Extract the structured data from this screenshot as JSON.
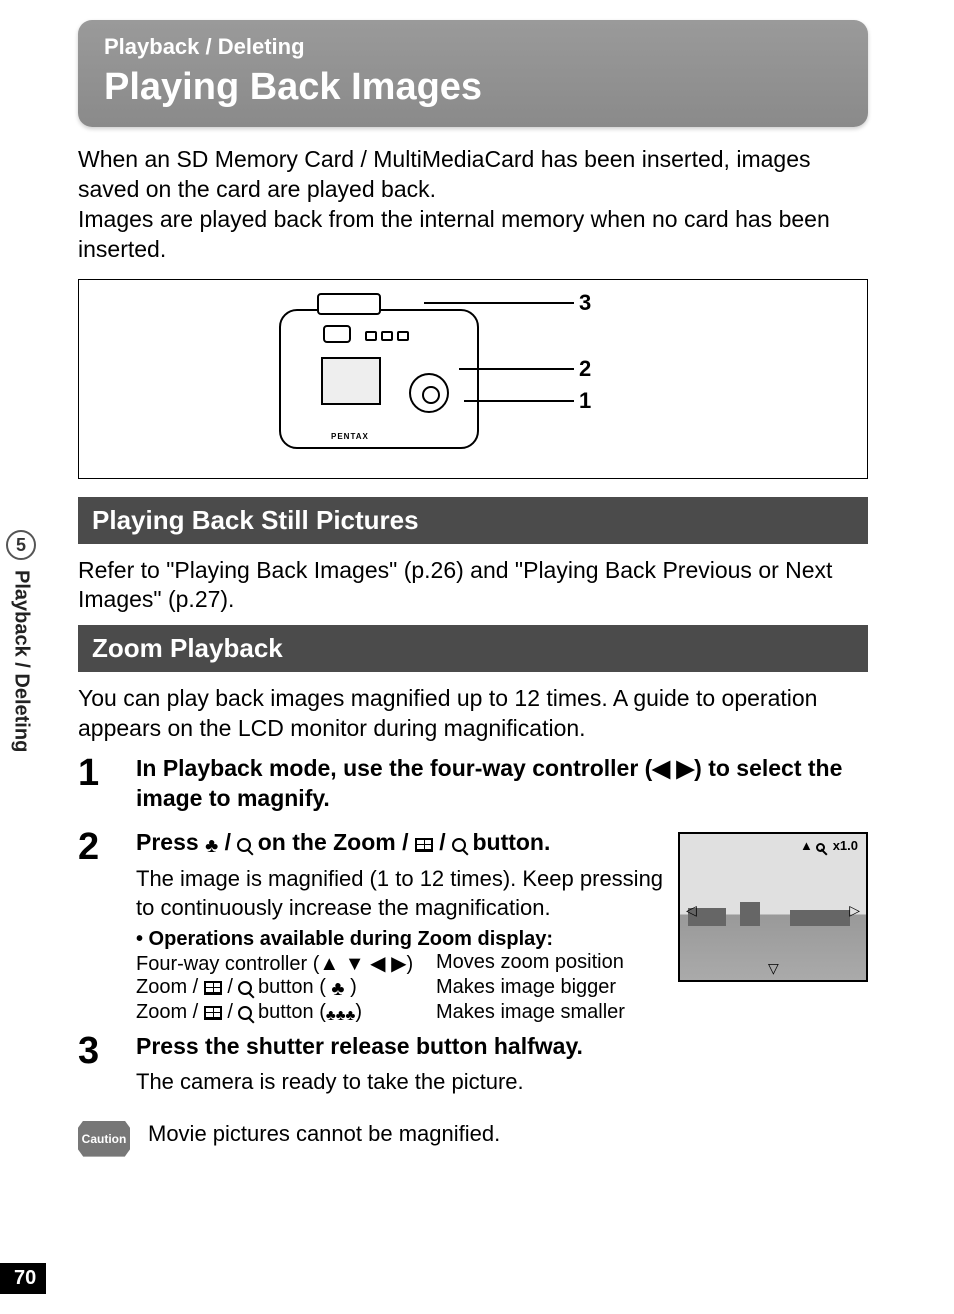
{
  "side_tab": {
    "number": "5",
    "label": "Playback / Deleting"
  },
  "page_number": "70",
  "header": {
    "breadcrumb": "Playback / Deleting",
    "title": "Playing Back Images"
  },
  "lead": "When an SD Memory Card / MultiMediaCard has been inserted, images saved on the card are played back.\nImages are played back from the internal memory when no card has been inserted.",
  "diagram": {
    "brand": "PENTAX",
    "callouts": [
      "1",
      "2",
      "3"
    ]
  },
  "sections": {
    "still": {
      "heading": "Playing Back Still Pictures",
      "text": "Refer to \"Playing Back Images\" (p.26) and \"Playing Back Previous or Next Images\" (p.27)."
    },
    "zoom": {
      "heading": "Zoom Playback",
      "text": "You can play back images magnified up to 12 times. A guide to operation appears on the LCD monitor during magnification."
    }
  },
  "steps": [
    {
      "num": "1",
      "title_pre": "In Playback mode, use the four-way controller (",
      "title_post": ") to select the image to magnify."
    },
    {
      "num": "2",
      "title_pre": "Press ",
      "title_mid": " on the Zoom / ",
      "title_post": " button.",
      "desc": "The image is magnified (1 to 12 times). Keep pressing to continuously increase the magnification.",
      "ops_head": "•  Operations available during Zoom display:",
      "ops": [
        {
          "left_pre": "Four-way controller (",
          "left_post": ")",
          "right": "Moves zoom position"
        },
        {
          "left_pre": "Zoom / ",
          "left_mid": " button ( ",
          "left_post": " )",
          "right": "Makes image bigger"
        },
        {
          "left_pre": "Zoom / ",
          "left_mid": " button (",
          "left_post": ")",
          "right": "Makes image smaller"
        }
      ]
    },
    {
      "num": "3",
      "title": "Press the shutter release button halfway.",
      "desc": "The camera is ready to take the picture."
    }
  ],
  "zoom_preview": {
    "overlay_pre": "▲   ",
    "overlay_mag": "x1.0"
  },
  "caution": {
    "badge": "Caution",
    "text": "Movie pictures cannot be magnified."
  }
}
